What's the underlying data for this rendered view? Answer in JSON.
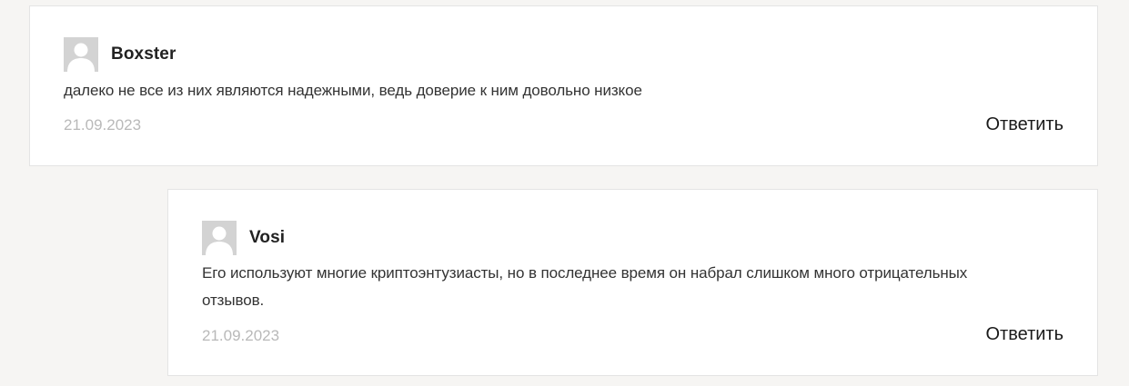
{
  "comments": [
    {
      "author": "Boxster",
      "text": "далеко не все из них являются надежными, ведь доверие к ним довольно низкое",
      "date": "21.09.2023",
      "reply_label": "Ответить",
      "avatar_icon": "default-user-avatar-icon"
    },
    {
      "author": "Vosi",
      "text": "Его используют многие криптоэнтузиасты, но в последнее время он набрал слишком много отрицательных отзывов.",
      "date": "21.09.2023",
      "reply_label": "Ответить",
      "avatar_icon": "default-user-avatar-icon"
    }
  ],
  "colors": {
    "page_background": "#f6f5f3",
    "card_background": "#ffffff",
    "card_border": "#e4e4e4",
    "date_text": "#b9b9b9",
    "avatar_background": "#d3d3d3"
  }
}
